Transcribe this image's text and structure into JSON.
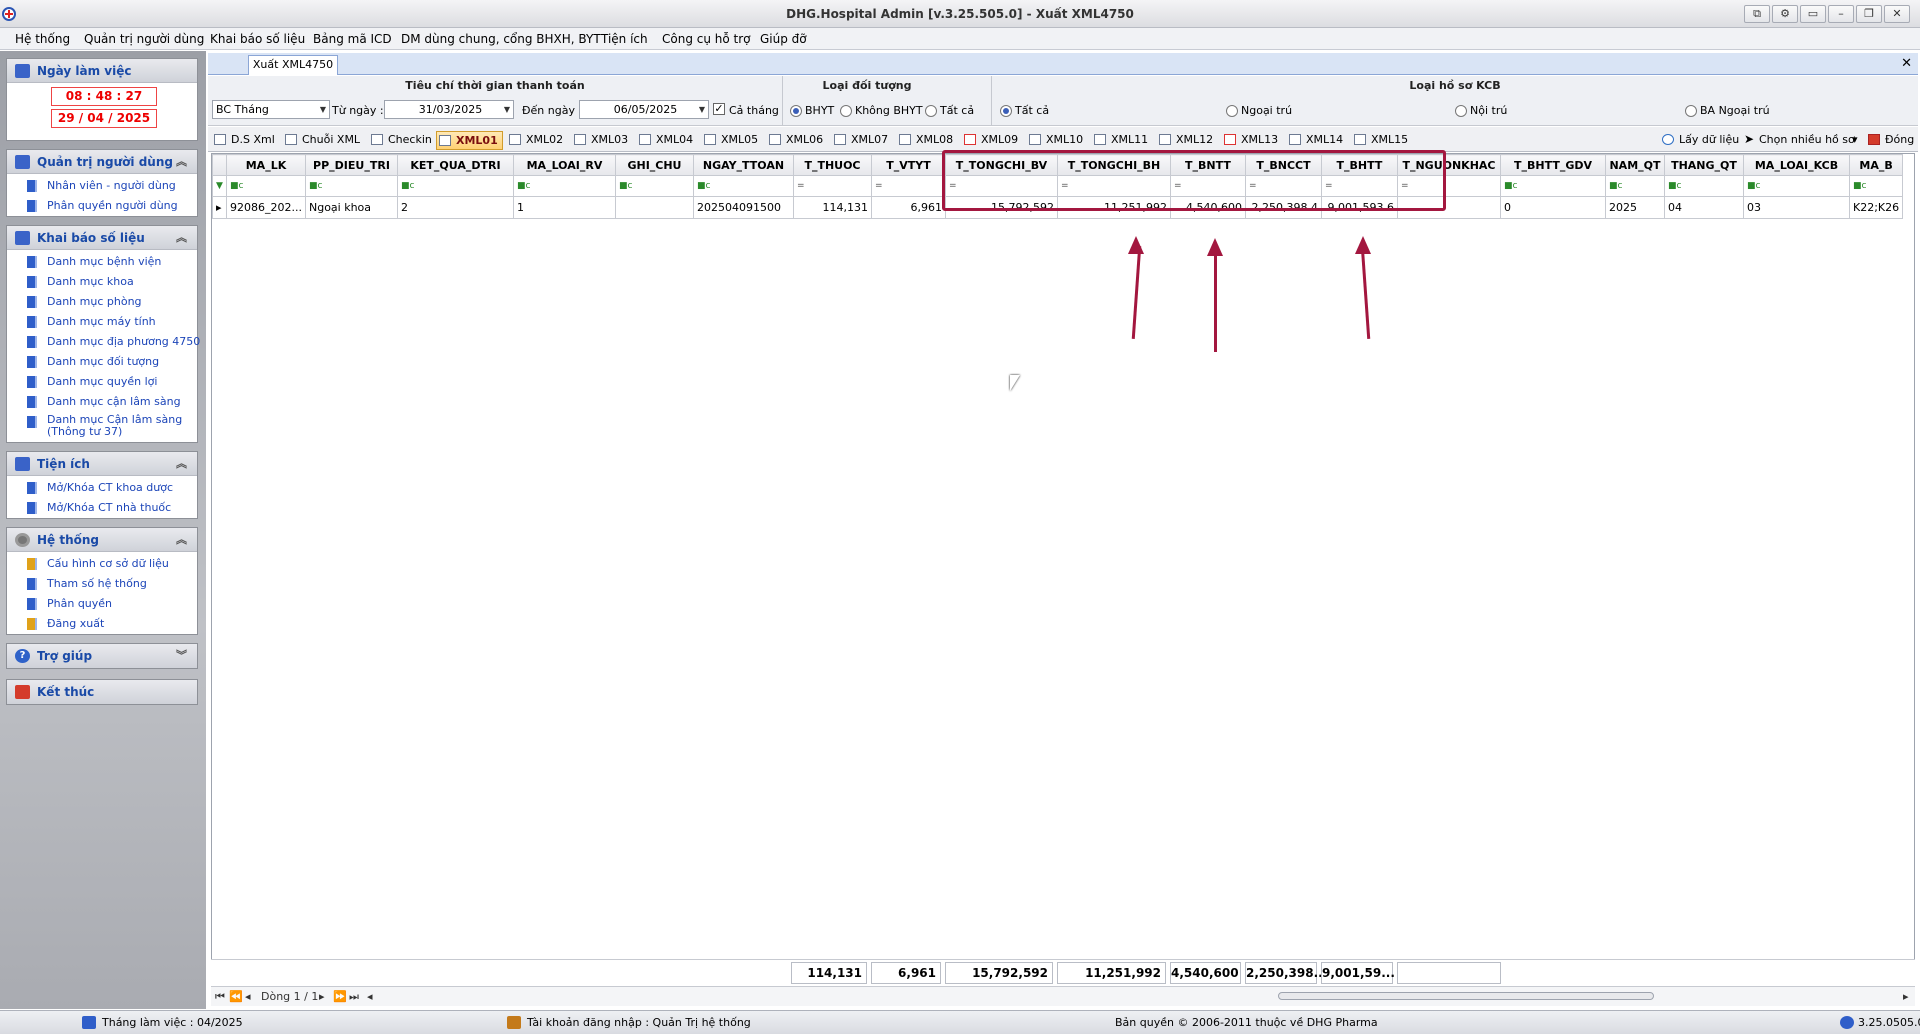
{
  "window": {
    "title": "DHG.Hospital Admin [v.3.25.505.0] - Xuất XML4750"
  },
  "menu": [
    "Hệ thống",
    "Quản trị người dùng",
    "Khai báo số liệu",
    "Bảng mã ICD",
    "DM dùng chung, cổng BHXH, BYT",
    "Tiện ích",
    "Công cụ hỗ trợ",
    "Giúp đỡ"
  ],
  "sidebar": {
    "workday": {
      "title": "Ngày làm việc",
      "time": "08 : 48 : 27",
      "date": "29 / 04 /  2025"
    },
    "admin": {
      "title": "Quản trị người dùng",
      "items": [
        "Nhân viên - người dùng",
        "Phân quyền người dùng"
      ]
    },
    "data": {
      "title": "Khai báo số liệu",
      "items": [
        "Danh mục bệnh viện",
        "Danh mục khoa",
        "Danh mục phòng",
        "Danh mục máy tính",
        "Danh mục địa phương 4750",
        "Danh mục đối tượng",
        "Danh mục quyền lợi",
        "Danh mục cận lâm sàng",
        "Danh mục Cận lâm sàng",
        "(Thông  tư 37)"
      ]
    },
    "utils": {
      "title": "Tiện ích",
      "items": [
        "Mở/Khóa CT khoa dược",
        "Mở/Khóa CT nhà thuốc"
      ]
    },
    "system": {
      "title": "Hệ thống",
      "items": [
        "Cấu hình cơ sở dữ liệu",
        "Tham số hệ thống",
        "Phân quyền",
        "Đăng xuất"
      ]
    },
    "help": {
      "title": "Trợ giúp"
    },
    "exit": {
      "title": "Kết thúc"
    }
  },
  "doc_tab": "Xuất XML4750",
  "filters": {
    "time_title": "Tiêu chí thời gian thanh toán",
    "report_type": "BC Tháng",
    "from_label": "Từ ngày :",
    "from_date": "31/03/2025",
    "to_label": "Đến ngày :",
    "to_date": "06/05/2025",
    "whole_month": "Cả tháng",
    "object_title": "Loại đối tượng",
    "object_options": [
      "BHYT",
      "Không BHYT",
      "Tất cả"
    ],
    "record_title": "Loại hồ sơ KCB",
    "record_options": [
      "Tất cả",
      "Ngoại trú",
      "Nội trú",
      "BA Ngoại trú"
    ]
  },
  "toolbar": {
    "tabs": [
      "D.S Xml",
      "Chuỗi XML",
      "Checkin",
      "XML01",
      "XML02",
      "XML03",
      "XML04",
      "XML05",
      "XML06",
      "XML07",
      "XML08",
      "XML09",
      "XML10",
      "XML11",
      "XML12",
      "XML13",
      "XML14",
      "XML15"
    ],
    "selected": "XML01",
    "fetch": "Lấy dữ liệu",
    "multi": "Chọn nhiều hồ sơ",
    "close": "Đóng"
  },
  "grid": {
    "columns": [
      "MA_LK",
      "PP_DIEU_TRI",
      "KET_QUA_DTRI",
      "MA_LOAI_RV",
      "GHI_CHU",
      "NGAY_TTOAN",
      "T_THUOC",
      "T_VTYT",
      "T_TONGCHI_BV",
      "T_TONGCHI_BH",
      "T_BNTT",
      "T_BNCCT",
      "T_BHTT",
      "T_NGUONKHAC",
      "T_BHTT_GDV",
      "NAM_QT",
      "THANG_QT",
      "MA_LOAI_KCB",
      "MA_B"
    ],
    "rows": [
      [
        "92086_202...",
        "Ngoại khoa",
        "2",
        "1",
        "",
        "202504091500",
        "114,131",
        "6,961",
        "15,792,592",
        "11,251,992",
        "4,540,600",
        "2,250,398.4",
        "9,001,593.6",
        "",
        "0",
        "2025",
        "04",
        "03",
        "K22;K26"
      ]
    ],
    "totals": [
      "114,131",
      "6,961",
      "15,792,592",
      "11,251,992",
      "4,540,600",
      "2,250,398...",
      "9,001,59...",
      ""
    ]
  },
  "nav": {
    "record": "Dòng 1 / 1"
  },
  "status": {
    "month": "Tháng làm việc : 04/2025",
    "account": "Tài khoản đăng nhập : Quản Trị hệ thống",
    "copyright": "Bản quyền © 2006-2011 thuộc về DHG Pharma",
    "version": "3.25.0505.0"
  },
  "colors": {
    "annotation": "#a3173f",
    "link": "#1c45b8",
    "time": "#e00000"
  }
}
